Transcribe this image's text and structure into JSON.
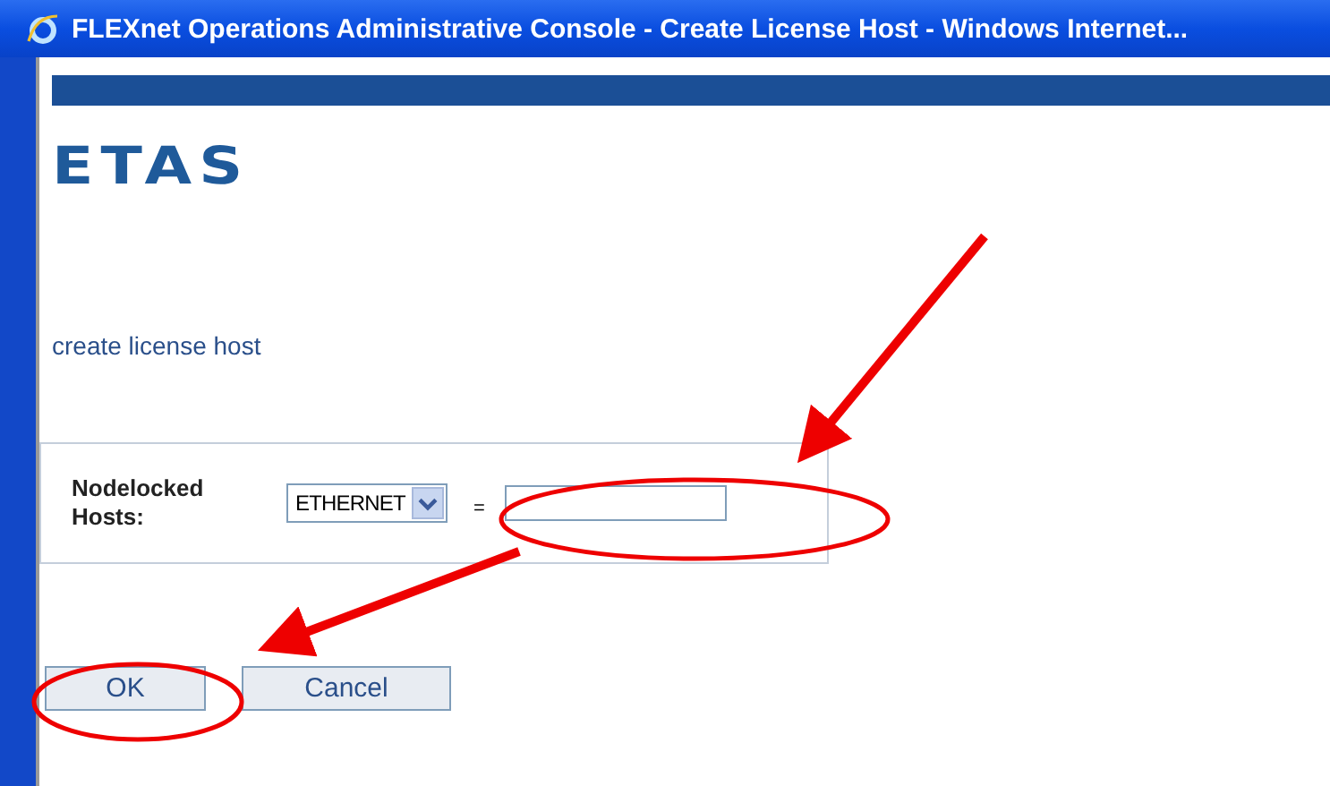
{
  "window": {
    "title": "FLEXnet Operations Administrative Console - Create License Host - Windows Internet..."
  },
  "logo": {
    "text": "ETAS"
  },
  "page_title": "create license host",
  "form": {
    "label": "Nodelocked Hosts:",
    "select": {
      "value": "ETHERNET"
    },
    "equals": "="
  },
  "buttons": [
    {
      "label": "OK",
      "highlighted": true
    },
    {
      "label": "Cancel",
      "highlighted": false
    }
  ]
}
